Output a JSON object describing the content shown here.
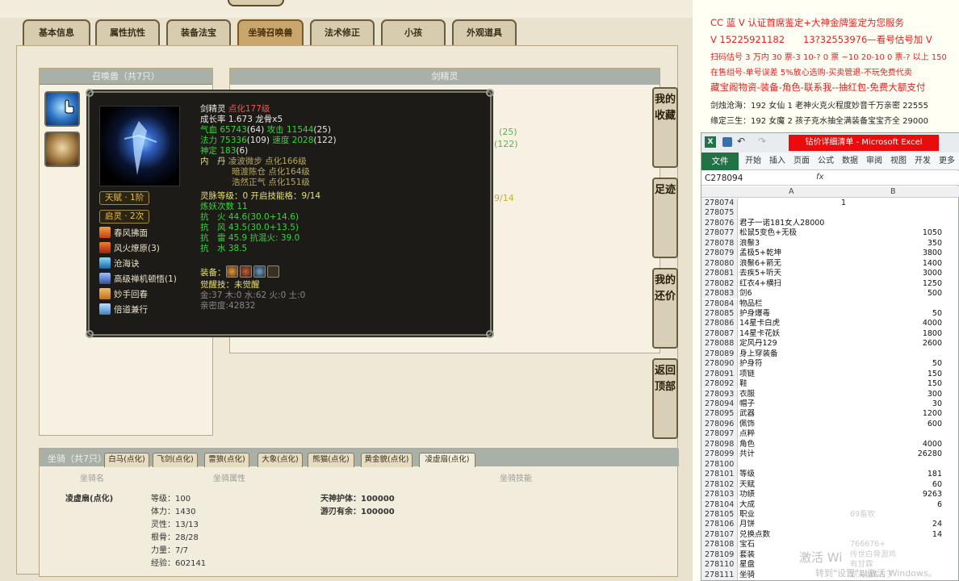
{
  "game": {
    "tabs": [
      "基本信息",
      "属性抗性",
      "装备法宝",
      "坐骑召唤兽",
      "法术修正",
      "小孩",
      "外观道具"
    ],
    "summon_panel_title": "召唤兽（共7只）",
    "detail_title": "剑精灵",
    "ghost": {
      "a": "(25)",
      "b": "(122)",
      "c": "9/14"
    },
    "tooltip": {
      "line1_name": "剑精灵",
      "line1_tag": "点化177级",
      "growth": "成长率 1.673 龙骨x5",
      "hp_label": "气血",
      "hp": "65743",
      "hp_pt": "(64)",
      "atk_label": "攻击",
      "atk": "11544",
      "atk_pt": "(25)",
      "mp_label": "法力",
      "mp": "75336",
      "mp_pt": "(109)",
      "spd_label": "速度",
      "spd": "2028",
      "spd_pt": "(122)",
      "def_label": "神定",
      "def": "183",
      "def_pt": "(6)",
      "neidan_label": "内　丹",
      "neidan1": "凌波微步 点化166级",
      "neidan2": "暗渡陈仓 点化164级",
      "neidan3": "浩然正气 点化151级",
      "spirit": "灵脉等级：0 开启技能格：9/14",
      "refine": "炼妖次数 11",
      "res1_a": "抗",
      "res1_b": "火",
      "res1_v": "44.6(30.0+14.6)",
      "res2_a": "抗",
      "res2_b": "风",
      "res2_v": "43.5(30.0+13.5)",
      "res3_a": "抗",
      "res3_b": "雷",
      "res3_v": "45.9 抗混火: 39.0",
      "res4_a": "抗",
      "res4_b": "水",
      "res4_v": "38.5",
      "equip_label": "装备：",
      "awaken": "觉醒技：未觉醒",
      "elements": "金:37 木:0 水:62 火:0 土:0",
      "intimacy": "亲密度:42832",
      "talent": "天赋 · 1阶",
      "qiling": "启灵 · 2次",
      "skills": [
        "春风拂面",
        "风火燎原(3)",
        "沧海诀",
        "高级禅机顿悟(1)",
        "妙手回春",
        "倍道兼行"
      ]
    },
    "side_buttons": [
      "我的收藏",
      "足迹",
      "我的还价",
      "返回顶部"
    ],
    "mount": {
      "header": "坐骑（共7只）",
      "tabs": [
        "白马(点化)",
        "飞剑(点化)",
        "雷狼(点化)",
        "大象(点化)",
        "熊猫(点化)",
        "黄金貌(点化)",
        "凌虚扇(点化)"
      ],
      "col_name": "坐骑名",
      "col_attr": "坐骑属性",
      "col_skill": "坐骑技能",
      "name": "凌虚扇(点化)",
      "attrs": [
        "等级：100",
        "体力：1430",
        "灵性：13/13",
        "根骨：28/28",
        "力量：7/7",
        "经验：602141"
      ],
      "skills": [
        "天神护体：100000",
        "游刃有余：100000"
      ]
    }
  },
  "right": {
    "ads": [
      "CC 蓝 V 认证首席鉴定+大神金牌鉴定为您服务",
      "V 15225921182　　13?32553976—看号估号加 V",
      "扫码估号 3 万内 30 票-3 10-? 0 票 ~10 20-10 0 票-? 以上 150",
      "在售组号-单号误差 5%放心选购-买卖管退-不玩免费代卖",
      "藏宝阁物资-装备-角色-联系我--抽红包-免费大额支付",
      "剑烛沧海：192 女仙 1 老神火克火程度妙音千万亲密 22555",
      "缘定三生：192 女魔 2 孩子克水抽全满装备宝宝齐全 29000"
    ],
    "excel": {
      "title": "钻价详细清单 - Microsoft Excel",
      "ribbon": [
        "文件",
        "开始",
        "插入",
        "页面",
        "公式",
        "数据",
        "审阅",
        "视图",
        "开发",
        "更多"
      ],
      "namebox": "C278094",
      "fx": "fx",
      "colA": "A",
      "colB": "B",
      "rows": [
        {
          "n": "278074",
          "a": "",
          "an": "1",
          "b": ""
        },
        {
          "n": "278075",
          "a": "",
          "b": ""
        },
        {
          "n": "278076",
          "a": "君子一诺181女人28000",
          "b": ""
        },
        {
          "n": "278077",
          "a": "松鼠5变色+无极",
          "b": "1050"
        },
        {
          "n": "278078",
          "a": "浪鬃3",
          "b": "350"
        },
        {
          "n": "278079",
          "a": "孟极5+乾坤",
          "b": "3800"
        },
        {
          "n": "278080",
          "a": "浪鬃6+箭无",
          "b": "1400"
        },
        {
          "n": "278081",
          "a": "去疾5+听天",
          "b": "3000"
        },
        {
          "n": "278082",
          "a": "红衣4+横扫",
          "b": "1250"
        },
        {
          "n": "278083",
          "a": "剑6",
          "b": "500"
        },
        {
          "n": "278084",
          "a": "物品栏",
          "b": ""
        },
        {
          "n": "278085",
          "a": "护身爆毒",
          "b": "50"
        },
        {
          "n": "278086",
          "a": "14星卡白虎",
          "b": "4000"
        },
        {
          "n": "278087",
          "a": "14星卡花妖",
          "b": "1800"
        },
        {
          "n": "278088",
          "a": "定风丹129",
          "b": "2600"
        },
        {
          "n": "278089",
          "a": "身上穿装备",
          "b": ""
        },
        {
          "n": "278090",
          "a": "护身符",
          "b": "50"
        },
        {
          "n": "278091",
          "a": "项链",
          "b": "150"
        },
        {
          "n": "278092",
          "a": "鞋",
          "b": "150"
        },
        {
          "n": "278093",
          "a": "衣服",
          "b": "300"
        },
        {
          "n": "278094",
          "a": "帽子",
          "b": "30"
        },
        {
          "n": "278095",
          "a": "武器",
          "b": "1200"
        },
        {
          "n": "278096",
          "a": "佩饰",
          "b": "600"
        },
        {
          "n": "278097",
          "a": "点粹",
          "b": ""
        },
        {
          "n": "278098",
          "a": "角色",
          "b": "4000"
        },
        {
          "n": "278099",
          "a": "共计",
          "b": "26280"
        },
        {
          "n": "278100",
          "a": "",
          "b": ""
        },
        {
          "n": "278101",
          "a": "等级",
          "b": "181"
        },
        {
          "n": "278102",
          "a": "天赋",
          "b": "60"
        },
        {
          "n": "278103",
          "a": "功绩",
          "b": "9263"
        },
        {
          "n": "278104",
          "a": "大成",
          "b": "6"
        },
        {
          "n": "278105",
          "a": "职业",
          "bl": "69畜牧"
        },
        {
          "n": "278106",
          "a": "月饼",
          "b": "24"
        },
        {
          "n": "278107",
          "a": "兑换点数",
          "b": "14"
        },
        {
          "n": "278108",
          "a": "宝石",
          "bl": "766676+"
        },
        {
          "n": "278109",
          "a": "套装",
          "bl": "传世白骨源鸡"
        },
        {
          "n": "278110",
          "a": "星盘",
          "bl": "有甘霖"
        },
        {
          "n": "278111",
          "a": "坐骑",
          "bl": "点满魔6人了"
        }
      ]
    },
    "watermark1": "激活 Wi",
    "watermark2": "转到\"设置\"以激活 Windows。"
  }
}
